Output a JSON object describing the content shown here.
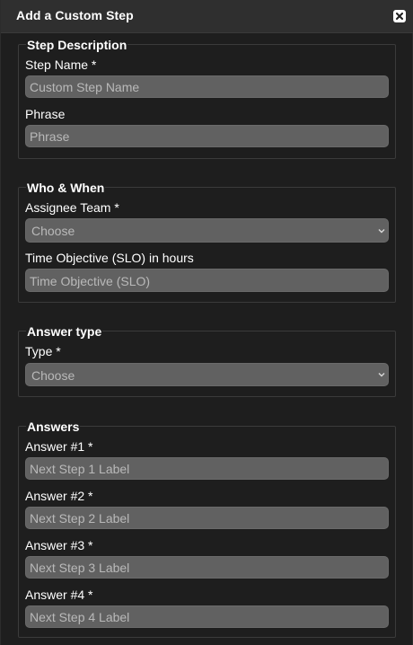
{
  "dialog": {
    "title": "Add a Custom Step"
  },
  "step_description": {
    "legend": "Step Description",
    "step_name_label": "Step Name *",
    "step_name_placeholder": "Custom Step Name",
    "phrase_label": "Phrase",
    "phrase_placeholder": "Phrase"
  },
  "who_when": {
    "legend": "Who & When",
    "assignee_label": "Assignee Team *",
    "assignee_selected": "Choose",
    "slo_label": "Time Objective (SLO) in hours",
    "slo_placeholder": "Time Objective (SLO)"
  },
  "answer_type": {
    "legend": "Answer type",
    "type_label": "Type *",
    "type_selected": "Choose"
  },
  "answers": {
    "legend": "Answers",
    "items": [
      {
        "label": "Answer #1 *",
        "placeholder": "Next Step 1 Label"
      },
      {
        "label": "Answer #2 *",
        "placeholder": "Next Step 2 Label"
      },
      {
        "label": "Answer #3 *",
        "placeholder": "Next Step 3 Label"
      },
      {
        "label": "Answer #4 *",
        "placeholder": "Next Step 4 Label"
      }
    ]
  },
  "icons": {
    "close": "close-icon",
    "dropdown": "chevron-down-icon"
  },
  "colors": {
    "background": "#1e1e1e",
    "titlebar": "#2f2f2f",
    "input_fill": "#616161",
    "placeholder_text": "#b9b9b9",
    "text": "#ffffff"
  }
}
